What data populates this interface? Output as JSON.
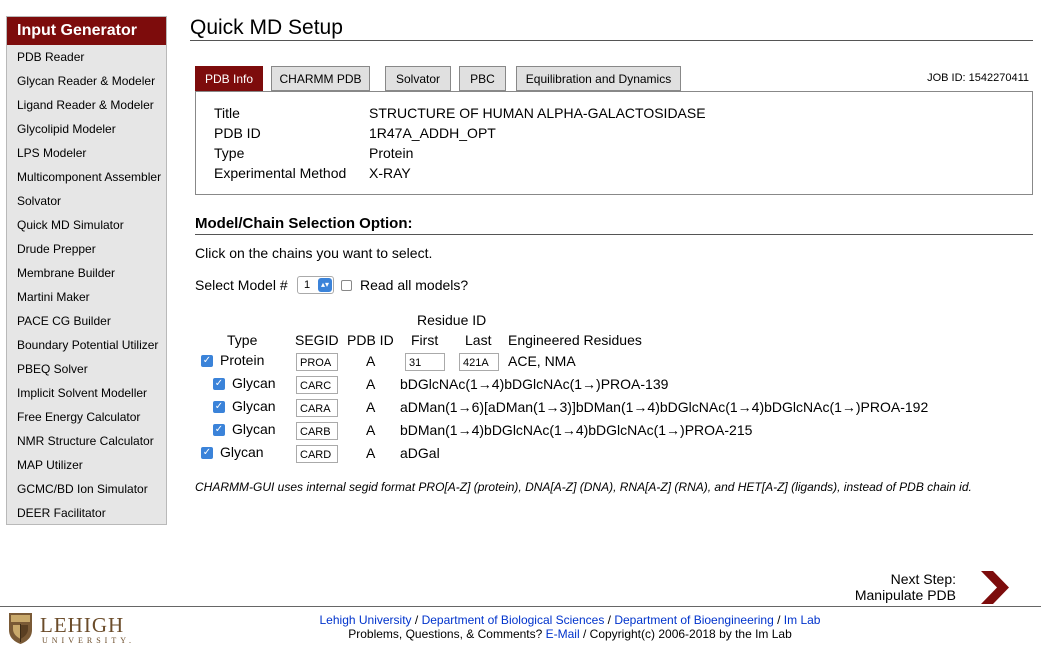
{
  "sidebar": {
    "title": "Input Generator",
    "items": [
      "PDB Reader",
      "Glycan Reader & Modeler",
      "Ligand Reader & Modeler",
      "Glycolipid Modeler",
      "LPS Modeler",
      "Multicomponent Assembler",
      "Solvator",
      "Quick MD Simulator",
      "Drude Prepper",
      "Membrane Builder",
      "Martini Maker",
      "PACE CG Builder",
      "Boundary Potential Utilizer",
      "PBEQ Solver",
      "Implicit Solvent Modeller",
      "Free Energy Calculator",
      "NMR Structure Calculator",
      "MAP Utilizer",
      "GCMC/BD Ion Simulator",
      "DEER Facilitator"
    ]
  },
  "page": {
    "title": "Quick MD Setup",
    "job_id": "JOB ID: 1542270411"
  },
  "tabs": [
    {
      "label": "PDB Info",
      "active": true
    },
    {
      "label": "CHARMM PDB",
      "active": false
    },
    {
      "label": "Solvator",
      "active": false
    },
    {
      "label": "PBC",
      "active": false
    },
    {
      "label": "Equilibration and Dynamics",
      "active": false
    }
  ],
  "info": [
    {
      "key": "Title",
      "value": "STRUCTURE OF HUMAN ALPHA-GALACTOSIDASE"
    },
    {
      "key": "PDB ID",
      "value": "1R47A_ADDH_OPT"
    },
    {
      "key": "Type",
      "value": "Protein"
    },
    {
      "key": "Experimental Method",
      "value": "X-RAY"
    }
  ],
  "selection": {
    "heading": "Model/Chain Selection Option:",
    "instruction": "Click on the chains you want to select.",
    "model_label": "Select Model #",
    "model_value": "1",
    "all_models_label": "Read all models?",
    "headers": {
      "residue_id": "Residue ID",
      "type": "Type",
      "segid": "SEGID",
      "pdb_id": "PDB ID",
      "first": "First",
      "last": "Last",
      "engineered": "Engineered Residues"
    },
    "rows": [
      {
        "type": "Protein",
        "segid": "PROA",
        "pdb_id": "A",
        "first": "31",
        "last": "421A",
        "residues": "ACE, NMA"
      },
      {
        "type": "Glycan",
        "segid": "CARC",
        "pdb_id": "A",
        "residues": "bDGlcNAc(1→4)bDGlcNAc(1→)PROA-139"
      },
      {
        "type": "Glycan",
        "segid": "CARA",
        "pdb_id": "A",
        "residues": "aDMan(1→6)[aDMan(1→3)]bDMan(1→4)bDGlcNAc(1→4)bDGlcNAc(1→)PROA-192"
      },
      {
        "type": "Glycan",
        "segid": "CARB",
        "pdb_id": "A",
        "residues": "bDMan(1→4)bDGlcNAc(1→4)bDGlcNAc(1→)PROA-215"
      },
      {
        "type": "Glycan",
        "segid": "CARD",
        "pdb_id": "A",
        "residues": "aDGal"
      }
    ],
    "note": "CHARMM-GUI uses internal segid format PRO[A-Z] (protein), DNA[A-Z] (DNA), RNA[A-Z] (RNA), and HET[A-Z] (ligands), instead of PDB chain id."
  },
  "next_step": {
    "line1": "Next Step:",
    "line2": "Manipulate PDB"
  },
  "footer": {
    "logo_name": "LEHIGH",
    "logo_sub": "UNIVERSITY.",
    "link1": "Lehigh University",
    "sep": " / ",
    "link2": "Department of Biological Sciences",
    "link3": "Department of Bioengineering",
    "link4": "Im Lab",
    "line2_pre": "Problems, Questions, & Comments? ",
    "email": "E-Mail",
    "line2_post": " / Copyright(c) 2006-2018 by the Im Lab"
  },
  "colors": {
    "brand": "#7d0c0c",
    "checkbox": "#3b83d9",
    "link": "#0033cc"
  }
}
